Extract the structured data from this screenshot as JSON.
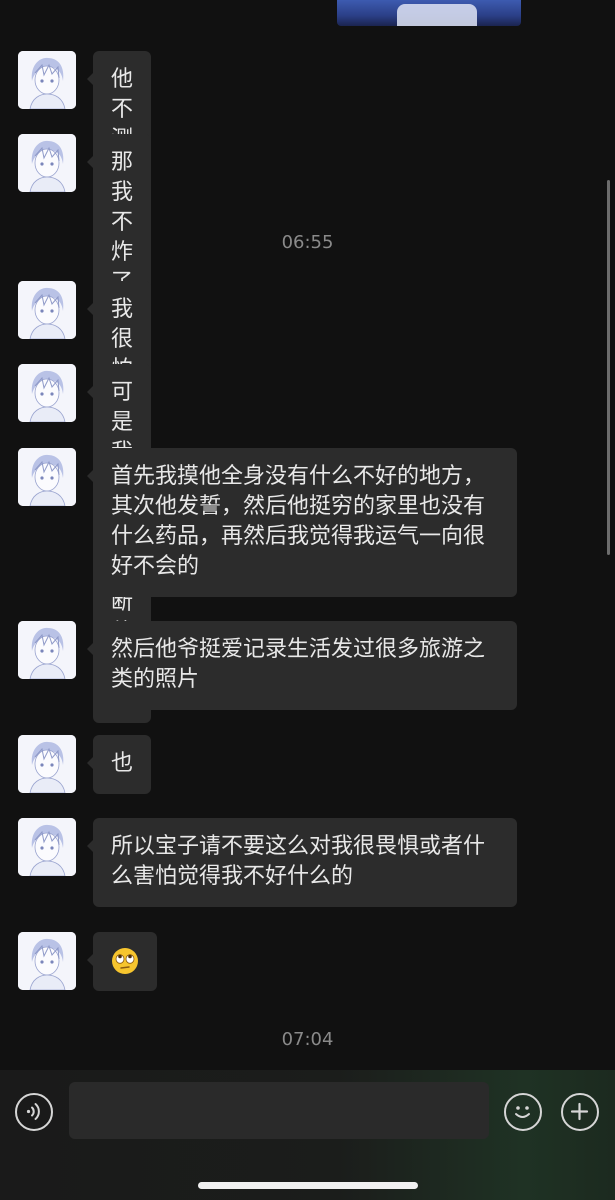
{
  "chat": {
    "messages": [
      {
        "text": "他不测呢"
      },
      {
        "text": "那我不炸了"
      },
      {
        "text": "我很怕啊"
      },
      {
        "text": "可是我觉得我推断他没事"
      },
      {
        "text": "首先我摸他全身没有什么不好的地方，其次他发誓，然后他挺穷的家里也没有什么药品，再然后我觉得我运气一向很好不会的"
      },
      {
        "text": "然后他爷挺爱记录生活发过很多旅游之类的照片"
      },
      {
        "text": "也"
      },
      {
        "text": "所以宝子请不要这么对我很畏惧或者什么害怕觉得我不好什么的"
      },
      {
        "text": "🙄"
      }
    ],
    "timestamps": [
      "06:55",
      "07:04"
    ]
  },
  "input_bar": {
    "message_value": "",
    "voice_icon": "voice-icon",
    "emoji_icon": "emoji-icon",
    "plus_icon": "plus-icon"
  },
  "colors": {
    "background": "#111111",
    "bubble": "#2c2c2c",
    "timestamp": "#8a8a8a"
  }
}
